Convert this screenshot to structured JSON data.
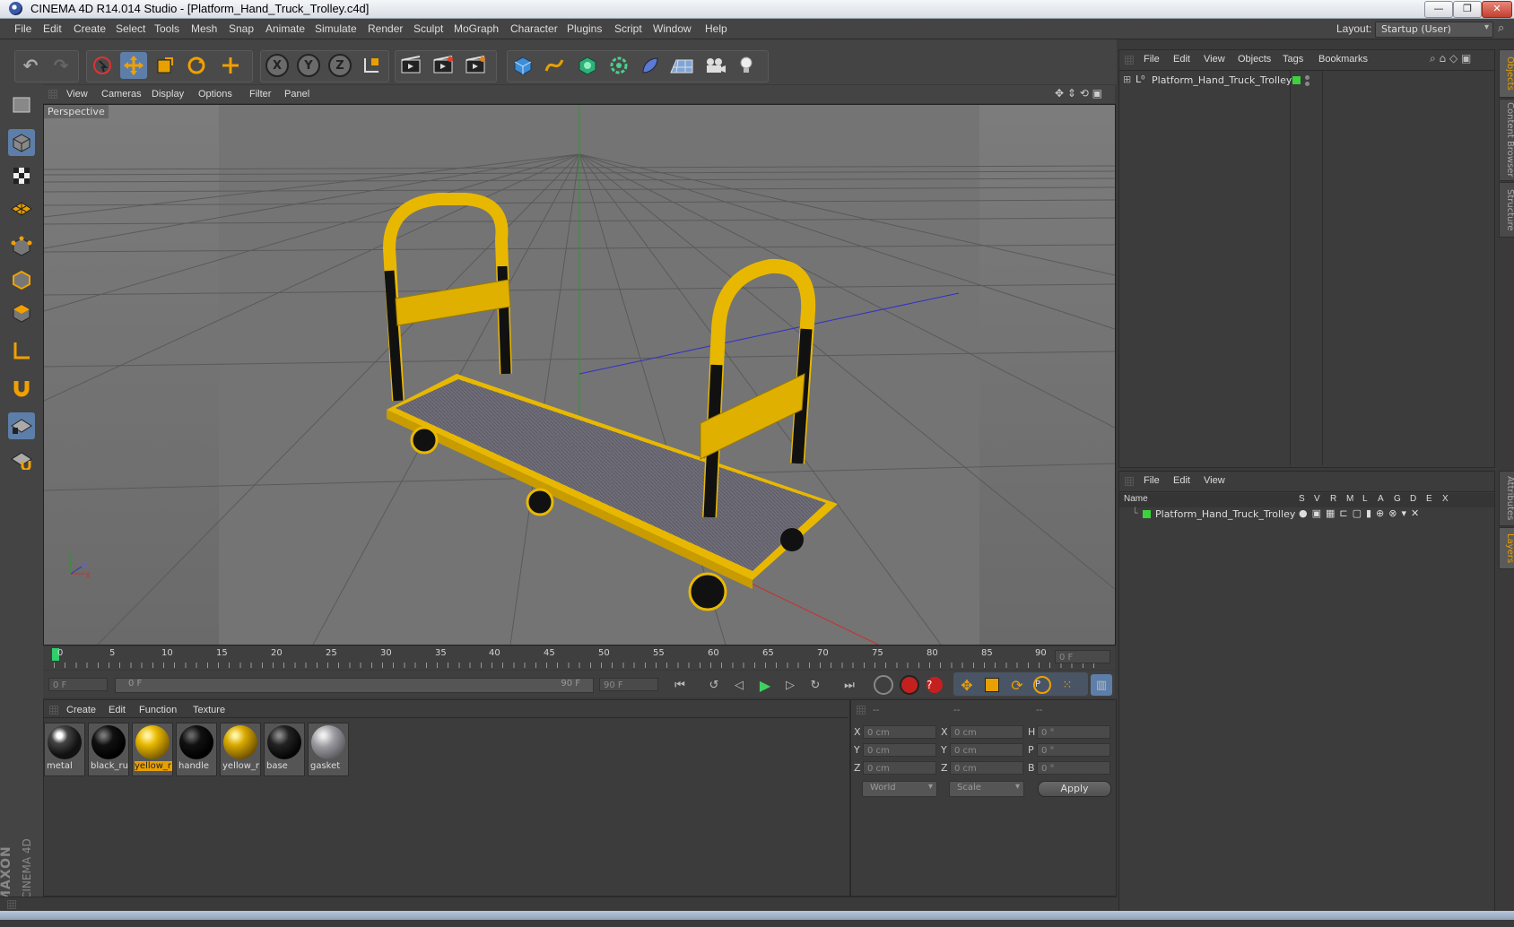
{
  "window": {
    "title": "CINEMA 4D R14.014 Studio - [Platform_Hand_Truck_Trolley.c4d]",
    "min_label": "—",
    "max_label": "❐",
    "close_label": "✕"
  },
  "menubar": {
    "items": [
      "File",
      "Edit",
      "Create",
      "Select",
      "Tools",
      "Mesh",
      "Snap",
      "Animate",
      "Simulate",
      "Render",
      "Sculpt",
      "MoGraph",
      "Character",
      "Plugins",
      "Script",
      "Window",
      "Help"
    ],
    "layout_label": "Layout:",
    "layout_value": "Startup (User)"
  },
  "viewport": {
    "menu": [
      "View",
      "Cameras",
      "Display",
      "Options",
      "Filter",
      "Panel"
    ],
    "label": "Perspective",
    "axis_y": "Y",
    "axis_x": "X",
    "axis_z": "Z"
  },
  "timeline": {
    "ticks": [
      "0",
      "5",
      "10",
      "15",
      "20",
      "25",
      "30",
      "35",
      "40",
      "45",
      "50",
      "55",
      "60",
      "65",
      "70",
      "75",
      "80",
      "85",
      "90"
    ],
    "current_frame": "0 F",
    "start_frame": "0 F",
    "range_start": "0 F",
    "range_end": "90 F",
    "end_frame": "90 F"
  },
  "materials": {
    "menu": [
      "Create",
      "Edit",
      "Function",
      "Texture"
    ],
    "items": [
      {
        "label": "metal",
        "color": "#1a1a1a",
        "selected": false
      },
      {
        "label": "black_ru",
        "color": "#0a0a0a",
        "selected": false
      },
      {
        "label": "yellow_r",
        "color": "#e0b000",
        "selected": true
      },
      {
        "label": "handle",
        "color": "#0c0c0c",
        "selected": false
      },
      {
        "label": "yellow_r",
        "color": "#d8aa00",
        "selected": false
      },
      {
        "label": "base",
        "color": "#111",
        "selected": false
      },
      {
        "label": "gasket",
        "color": "#8a8a90",
        "selected": false
      }
    ]
  },
  "coords": {
    "headers": [
      "--",
      "--",
      "--"
    ],
    "rows": [
      {
        "a": "X",
        "av": "0 cm",
        "b": "X",
        "bv": "0 cm",
        "c": "H",
        "cv": "0 °"
      },
      {
        "a": "Y",
        "av": "0 cm",
        "b": "Y",
        "bv": "0 cm",
        "c": "P",
        "cv": "0 °"
      },
      {
        "a": "Z",
        "av": "0 cm",
        "b": "Z",
        "bv": "0 cm",
        "c": "B",
        "cv": "0 °"
      }
    ],
    "mode1": "World",
    "mode2": "Scale",
    "apply": "Apply"
  },
  "objects": {
    "menu": [
      "File",
      "Edit",
      "View",
      "Objects",
      "Tags",
      "Bookmarks"
    ],
    "item": "Platform_Hand_Truck_Trolley"
  },
  "layers": {
    "menu": [
      "File",
      "Edit",
      "View"
    ],
    "col_name": "Name",
    "cols": [
      "S",
      "V",
      "R",
      "M",
      "L",
      "A",
      "G",
      "D",
      "E",
      "X"
    ],
    "item": "Platform_Hand_Truck_Trolley"
  },
  "side_tabs": [
    "Objects",
    "Content Browser",
    "Structure",
    "Attributes",
    "Layers"
  ],
  "brand": {
    "maxon": "MAXON",
    "product": "CINEMA 4D"
  },
  "colors": {
    "accent": "#5d7ea8",
    "yellow": "#e8b800",
    "green_layer": "#3bd23b"
  }
}
